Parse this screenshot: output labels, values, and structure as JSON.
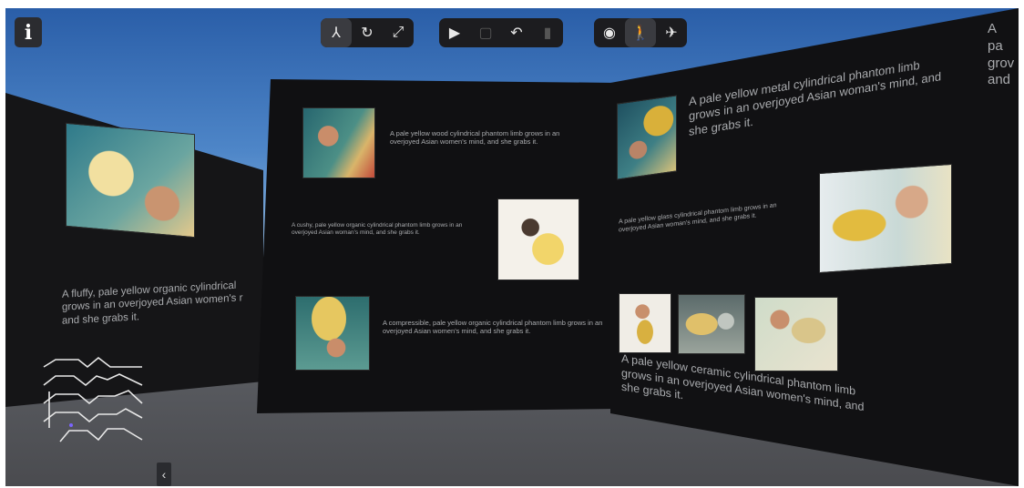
{
  "info_button": {
    "label": "i"
  },
  "toolbar": {
    "group1": [
      {
        "icon": "axis-icon",
        "glyph": "⅄",
        "active": true
      },
      {
        "icon": "rotate-icon",
        "glyph": "↻",
        "active": false
      },
      {
        "icon": "fullscreen-icon",
        "glyph": "⤢",
        "active": false
      }
    ],
    "group2": [
      {
        "icon": "play-tour-icon",
        "glyph": "▶",
        "active": false
      },
      {
        "icon": "copy-icon",
        "glyph": "▢",
        "active": false,
        "dim": true
      },
      {
        "icon": "undo-icon",
        "glyph": "↶",
        "active": false
      },
      {
        "icon": "delete-icon",
        "glyph": "▮",
        "active": false,
        "dim": true
      }
    ],
    "group3": [
      {
        "icon": "orbit-view-icon",
        "glyph": "◉",
        "active": false
      },
      {
        "icon": "walk-mode-icon",
        "glyph": "🚶",
        "active": true
      },
      {
        "icon": "drone-mode-icon",
        "glyph": "✈",
        "active": false
      }
    ]
  },
  "left_wall": {
    "caption": "A fluffy, pale yellow organic cylindrical grows in an overjoyed Asian women's r and she grabs it."
  },
  "center_wall": {
    "items": [
      {
        "text": "A pale yellow wood cylindrical phantom limb grows in an overjoyed Asian women's mind, and she grabs it."
      },
      {
        "text": "A cushy, pale yellow organic cylindrical phantom limb grows in an overjoyed Asian woman's mind, and she grabs it."
      },
      {
        "text": "A compressible, pale yellow organic cylindrical phantom limb grows in an overjoyed Asian women's mind, and she grabs it."
      }
    ]
  },
  "right_wall": {
    "item1": "A pale yellow metal cylindrical phantom limb grows in an overjoyed Asian woman's mind, and she grabs it.",
    "item2": "A pale yellow glass cylindrical phantom limb grows in an overjoyed Asian woman's mind, and she grabs it.",
    "item3": "A pale yellow ceramic cylindrical phantom limb grows in an overjoyed Asian women's mind, and she grabs it.",
    "far_edge": "A pa grov and"
  },
  "minimap": {
    "icon": "minimap-icon"
  },
  "collapse": {
    "glyph": "‹"
  }
}
